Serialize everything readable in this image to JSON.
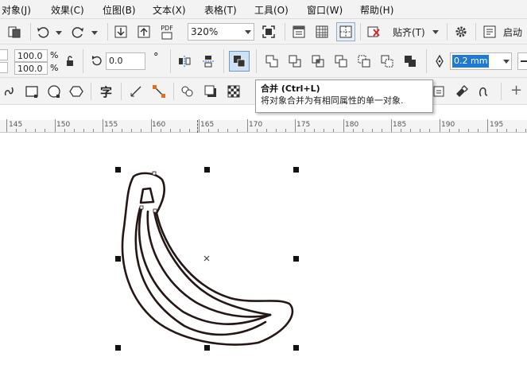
{
  "menubar": {
    "items": [
      "对象(J)",
      "效果(C)",
      "位图(B)",
      "文本(X)",
      "表格(T)",
      "工具(O)",
      "窗口(W)",
      "帮助(H)"
    ]
  },
  "toolbar1": {
    "zoom_value": "320%",
    "snap_label": "贴齐(T)",
    "launch_label": "启动",
    "pdf_label": "PDF"
  },
  "toolbar2": {
    "scale_x": "100.0",
    "scale_y": "100.0",
    "percent": "%",
    "rotation": "0.0",
    "degree": "°",
    "outline_width": "0.2 mm"
  },
  "toolbar3": {
    "text_tool": "字",
    "plus": "+"
  },
  "tooltip": {
    "title": "合并 (Ctrl+L)",
    "description": "将对象合并为有相同属性的单一对象."
  },
  "ruler": {
    "labels": [
      "145",
      "150",
      "155",
      "160",
      "165",
      "170",
      "175",
      "180",
      "185",
      "190",
      "195"
    ]
  },
  "colors": {
    "menubar_bg": "#f3f3f3",
    "toolbar_bg": "#f3f3f3",
    "highlight_blue": "#1e7ad6",
    "banana_stroke": "#231815"
  }
}
